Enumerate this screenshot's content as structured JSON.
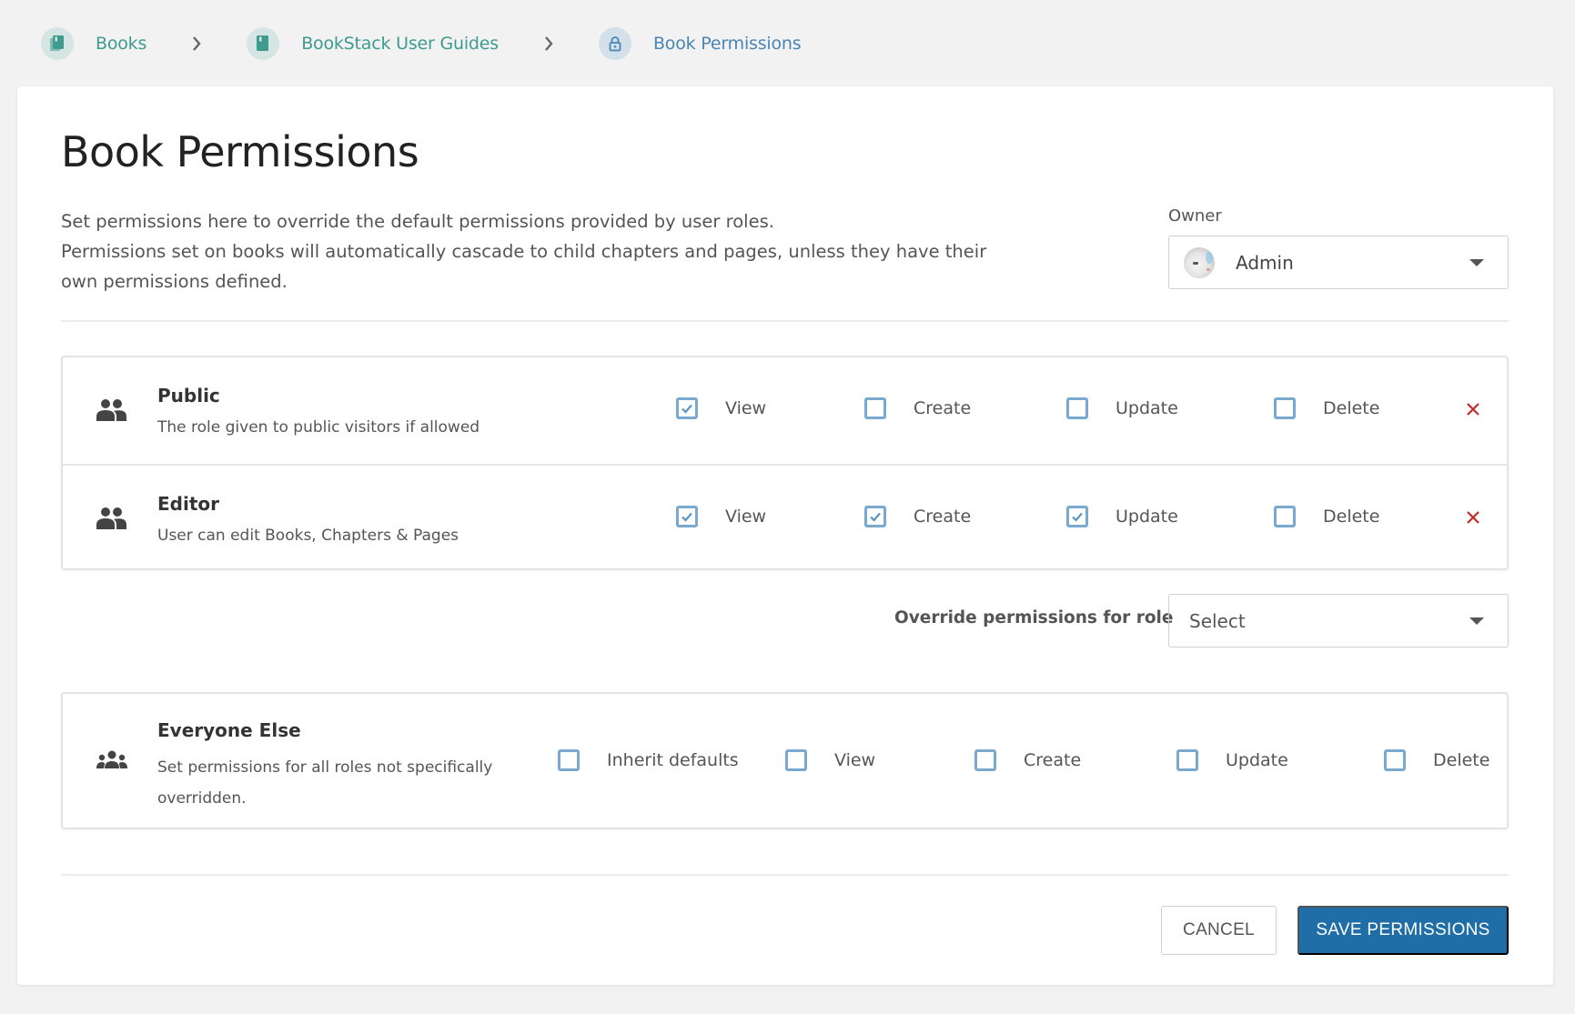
{
  "breadcrumb": [
    {
      "label": "Books",
      "icon": "books-icon"
    },
    {
      "label": "BookStack User Guides",
      "icon": "book-icon"
    },
    {
      "label": "Book Permissions",
      "icon": "lock-icon"
    }
  ],
  "page": {
    "title": "Book Permissions",
    "intro_line1": "Set permissions here to override the default permissions provided by user roles.",
    "intro_line2": "Permissions set on books will automatically cascade to child chapters and pages, unless they have their own permissions defined."
  },
  "owner": {
    "label": "Owner",
    "value": "Admin"
  },
  "roles": [
    {
      "name": "Public",
      "description": "The role given to public visitors if allowed",
      "permissions": [
        {
          "label": "View",
          "checked": true
        },
        {
          "label": "Create",
          "checked": false
        },
        {
          "label": "Update",
          "checked": false
        },
        {
          "label": "Delete",
          "checked": false
        }
      ]
    },
    {
      "name": "Editor",
      "description": "User can edit Books, Chapters & Pages",
      "permissions": [
        {
          "label": "View",
          "checked": true
        },
        {
          "label": "Create",
          "checked": true
        },
        {
          "label": "Update",
          "checked": true
        },
        {
          "label": "Delete",
          "checked": false
        }
      ]
    }
  ],
  "override": {
    "label": "Override permissions for role",
    "value": "Select"
  },
  "everyone_else": {
    "name": "Everyone Else",
    "description": "Set permissions for all roles not specifically overridden.",
    "permissions": [
      {
        "label": "Inherit defaults",
        "checked": false
      },
      {
        "label": "View",
        "checked": false
      },
      {
        "label": "Create",
        "checked": false
      },
      {
        "label": "Update",
        "checked": false
      },
      {
        "label": "Delete",
        "checked": false
      }
    ]
  },
  "actions": {
    "cancel_label": "CANCEL",
    "save_label": "SAVE PERMISSIONS"
  },
  "colors": {
    "primary": "#206ea7",
    "book_link": "#3e9b8e",
    "current_link": "#4a86b5",
    "remove": "#c62828",
    "checkbox": "#7aa9cf"
  }
}
